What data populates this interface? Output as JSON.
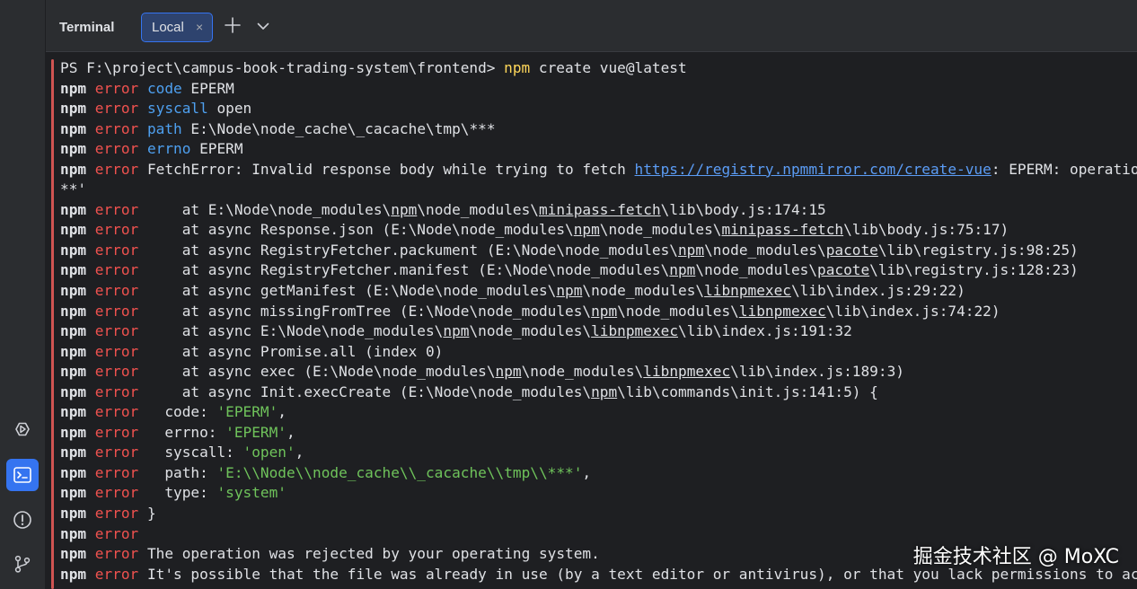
{
  "panel": {
    "title": "Terminal",
    "tabs": [
      {
        "label": "Local",
        "close": "×"
      }
    ]
  },
  "sidebar": {
    "icons": [
      "run-debug-icon",
      "terminal-icon",
      "problems-icon",
      "git-branch-icon"
    ]
  },
  "terminal": {
    "prompt": "PS F:\\project\\campus-book-trading-system\\frontend> ",
    "command_program": "npm",
    "command_args": " create vue@latest",
    "npm": "npm",
    "error": "error",
    "lines": [
      [
        [
          "k",
          "code"
        ],
        [
          "t",
          " EPERM"
        ]
      ],
      [
        [
          "k",
          "syscall"
        ],
        [
          "t",
          " open"
        ]
      ],
      [
        [
          "k",
          "path"
        ],
        [
          "t",
          " E:\\Node\\node_cache\\_cacache\\tmp\\***"
        ]
      ],
      [
        [
          "k",
          "errno"
        ],
        [
          "t",
          " EPERM"
        ]
      ],
      [
        [
          "t",
          "FetchError: Invalid response body while trying to fetch "
        ],
        [
          "url",
          "https://registry.npmmirror.com/create-vue"
        ],
        [
          "t",
          ": EPERM: operation not permitted, open 'E:\\Node\\node_cache\\_cacache\\tmp\\***"
        ]
      ],
      "CONT",
      [
        [
          "t",
          "    at E:\\Node\\node_modules\\"
        ],
        [
          "u",
          "npm"
        ],
        [
          "t",
          "\\node_modules\\"
        ],
        [
          "u",
          "minipass-fetch"
        ],
        [
          "t",
          "\\lib\\body.js:174:15"
        ]
      ],
      [
        [
          "t",
          "    at async Response.json (E:\\Node\\node_modules\\"
        ],
        [
          "u",
          "npm"
        ],
        [
          "t",
          "\\node_modules\\"
        ],
        [
          "u",
          "minipass-fetch"
        ],
        [
          "t",
          "\\lib\\body.js:75:17)"
        ]
      ],
      [
        [
          "t",
          "    at async RegistryFetcher.packument (E:\\Node\\node_modules\\"
        ],
        [
          "u",
          "npm"
        ],
        [
          "t",
          "\\node_modules\\"
        ],
        [
          "u",
          "pacote"
        ],
        [
          "t",
          "\\lib\\registry.js:98:25)"
        ]
      ],
      [
        [
          "t",
          "    at async RegistryFetcher.manifest (E:\\Node\\node_modules\\"
        ],
        [
          "u",
          "npm"
        ],
        [
          "t",
          "\\node_modules\\"
        ],
        [
          "u",
          "pacote"
        ],
        [
          "t",
          "\\lib\\registry.js:128:23)"
        ]
      ],
      [
        [
          "t",
          "    at async getManifest (E:\\Node\\node_modules\\"
        ],
        [
          "u",
          "npm"
        ],
        [
          "t",
          "\\node_modules\\"
        ],
        [
          "u",
          "libnpmexec"
        ],
        [
          "t",
          "\\lib\\index.js:29:22)"
        ]
      ],
      [
        [
          "t",
          "    at async missingFromTree (E:\\Node\\node_modules\\"
        ],
        [
          "u",
          "npm"
        ],
        [
          "t",
          "\\node_modules\\"
        ],
        [
          "u",
          "libnpmexec"
        ],
        [
          "t",
          "\\lib\\index.js:74:22)"
        ]
      ],
      [
        [
          "t",
          "    at async E:\\Node\\node_modules\\"
        ],
        [
          "u",
          "npm"
        ],
        [
          "t",
          "\\node_modules\\"
        ],
        [
          "u",
          "libnpmexec"
        ],
        [
          "t",
          "\\lib\\index.js:191:32"
        ]
      ],
      [
        [
          "t",
          "    at async Promise.all (index 0)"
        ]
      ],
      [
        [
          "t",
          "    at async exec (E:\\Node\\node_modules\\"
        ],
        [
          "u",
          "npm"
        ],
        [
          "t",
          "\\node_modules\\"
        ],
        [
          "u",
          "libnpmexec"
        ],
        [
          "t",
          "\\lib\\index.js:189:3)"
        ]
      ],
      [
        [
          "t",
          "    at async Init.execCreate (E:\\Node\\node_modules\\"
        ],
        [
          "u",
          "npm"
        ],
        [
          "t",
          "\\lib\\commands\\init.js:141:5) {"
        ]
      ],
      [
        [
          "t",
          "  code: "
        ],
        [
          "s",
          "'EPERM'"
        ],
        [
          "t",
          ","
        ]
      ],
      [
        [
          "t",
          "  errno: "
        ],
        [
          "s",
          "'EPERM'"
        ],
        [
          "t",
          ","
        ]
      ],
      [
        [
          "t",
          "  syscall: "
        ],
        [
          "s",
          "'open'"
        ],
        [
          "t",
          ","
        ]
      ],
      [
        [
          "t",
          "  path: "
        ],
        [
          "s",
          "'E:\\\\Node\\\\node_cache\\\\_cacache\\\\tmp\\\\***'"
        ],
        [
          "t",
          ","
        ]
      ],
      [
        [
          "t",
          "  type: "
        ],
        [
          "s",
          "'system'"
        ]
      ],
      [
        [
          "t",
          "}"
        ]
      ],
      [],
      [
        [
          "t",
          "The operation was rejected by your operating system."
        ]
      ],
      [
        [
          "t",
          "It's possible that the file was already in use (by a text editor or antivirus), or that you lack permissions to access it."
        ]
      ]
    ],
    "continuation": "**'"
  },
  "watermark": "掘金技术社区 @ MoXC"
}
